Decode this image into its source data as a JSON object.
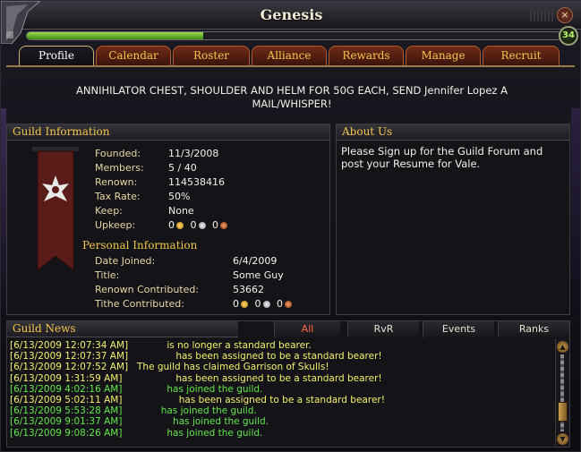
{
  "window": {
    "title": "Genesis",
    "level": "34",
    "progress_fraction": 0.33,
    "close_glyph": "×"
  },
  "tabs": [
    {
      "label": "Profile",
      "active": true
    },
    {
      "label": "Calendar"
    },
    {
      "label": "Roster"
    },
    {
      "label": "Alliance"
    },
    {
      "label": "Rewards"
    },
    {
      "label": "Manage"
    },
    {
      "label": "Recruit"
    }
  ],
  "motd": {
    "line1": "ANNIHILATOR CHEST, SHOULDER AND HELM FOR 50G EACH, SEND Jennifer Lopez      A",
    "line2": "MAIL/WHISPER!"
  },
  "guild_info": {
    "header": "Guild Information",
    "founded_label": "Founded:",
    "founded": "11/3/2008",
    "members_label": "Members:",
    "members": "5 / 40",
    "renown_label": "Renown:",
    "renown": "114538416",
    "tax_label": "Tax Rate:",
    "tax": "50%",
    "keep_label": "Keep:",
    "keep": "None",
    "upkeep_label": "Upkeep:",
    "upkeep_gold": "0",
    "upkeep_silver": "0",
    "upkeep_copper": "0"
  },
  "personal": {
    "header": "Personal Information",
    "joined_label": "Date Joined:",
    "joined": "6/4/2009",
    "title_label": "Title:",
    "title": "Some Guy",
    "renown_label": "Renown Contributed:",
    "renown": "53662",
    "tithe_label": "Tithe Contributed:",
    "tithe_gold": "0",
    "tithe_silver": "0",
    "tithe_copper": "0"
  },
  "about": {
    "header": "About Us",
    "text": "Please Sign up for the Guild Forum and post your Resume for Vale."
  },
  "news": {
    "header": "Guild News",
    "filters": [
      {
        "label": "All",
        "active": true
      },
      {
        "label": "RvR"
      },
      {
        "label": "Events"
      },
      {
        "label": "Ranks"
      }
    ],
    "items": [
      {
        "ts": "[6/13/2009 12:07:34 AM]",
        "text": "          is no longer a standard bearer.",
        "color": "#f4f06a"
      },
      {
        "ts": "[6/13/2009 12:07:37 AM]",
        "text": "             has been assigned to be a standard bearer!",
        "color": "#f4f06a"
      },
      {
        "ts": "[6/13/2009 12:07:52 AM]",
        "text": "The guild has claimed Garrison of Skulls!",
        "color": "#f4f06a"
      },
      {
        "ts": "[6/13/2009 1:31:59 AM]",
        "text": "             has been assigned to be a standard bearer!",
        "color": "#f4f06a"
      },
      {
        "ts": "[6/13/2009 4:02:16 AM]",
        "text": "          has joined the guild.",
        "color": "#62e64a"
      },
      {
        "ts": "[6/13/2009 5:02:11 AM]",
        "text": "              has been assigned to be a standard bearer!",
        "color": "#f4f06a"
      },
      {
        "ts": "[6/13/2009 5:53:28 AM]",
        "text": "        has joined the guild.",
        "color": "#62e64a"
      },
      {
        "ts": "[6/13/2009 9:01:37 AM]",
        "text": "            has joined the guild.",
        "color": "#62e64a"
      },
      {
        "ts": "[6/13/2009 9:08:26 AM]",
        "text": "          has joined the guild.",
        "color": "#62e64a"
      }
    ]
  }
}
